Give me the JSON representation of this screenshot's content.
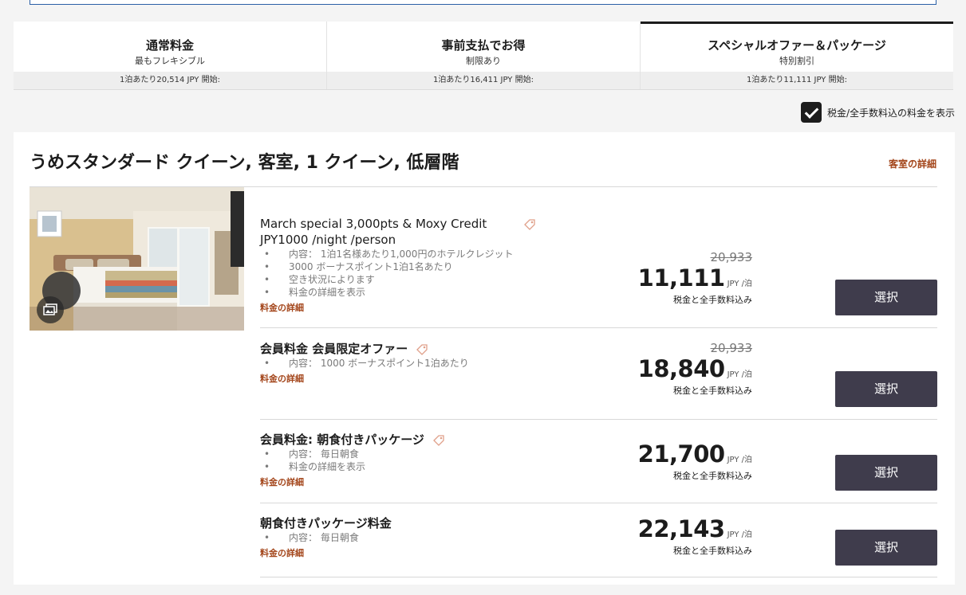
{
  "tabs": [
    {
      "title": "通常料金",
      "subtitle": "最もフレキシブル",
      "price": "1泊あたり20,514 JPY 開始:"
    },
    {
      "title": "事前支払でお得",
      "subtitle": "制限あり",
      "price": "1泊あたり16,411 JPY 開始:"
    },
    {
      "title": "スペシャルオファー＆パッケージ",
      "subtitle": "特別割引",
      "price": "1泊あたり11,111 JPY 開始:"
    }
  ],
  "tax_toggle": {
    "label": "税金/全手数料込の料金を表示",
    "checked": true
  },
  "room": {
    "title": "うめスタンダード クイーン, 客室, 1 クイーン, 低層階",
    "details_link": "客室の詳細",
    "photo_icon": "gallery-icon"
  },
  "rates": [
    {
      "name_line1": "March special 3,000pts & Moxy Credit",
      "name_line2": "JPY1000 /night /person",
      "bullets": [
        "内容： 1泊1名様あたり1,000円のホテルクレジット",
        "3000 ボーナスポイント1泊1名あたり",
        "空き状況によります",
        "料金の詳細を表示"
      ],
      "link": "料金の詳細",
      "original": "20,933",
      "price": "11,111",
      "unit": "JPY /泊",
      "note": "税金と全手数料込み",
      "button": "選択"
    },
    {
      "name_line1": "会員料金 会員限定オファー",
      "bullets": [
        "内容： 1000 ボーナスポイント1泊あたり"
      ],
      "link": "料金の詳細",
      "original": "20,933",
      "price": "18,840",
      "unit": "JPY /泊",
      "note": "税金と全手数料込み",
      "button": "選択"
    },
    {
      "name_line1": "会員料金: 朝食付きパッケージ",
      "bullets": [
        "内容： 毎日朝食",
        "料金の詳細を表示"
      ],
      "link": "料金の詳細",
      "price": "21,700",
      "unit": "JPY /泊",
      "note": "税金と全手数料込み",
      "button": "選択"
    },
    {
      "name_line1": "朝食付きパッケージ料金",
      "bullets": [
        "内容： 毎日朝食"
      ],
      "link": "料金の詳細",
      "price": "22,143",
      "unit": "JPY /泊",
      "note": "税金と全手数料込み",
      "button": "選択"
    }
  ],
  "colors": {
    "accent_link": "#a3451a",
    "button_bg": "#3f3c4c",
    "active_tab_border": "#1c1c1c"
  }
}
